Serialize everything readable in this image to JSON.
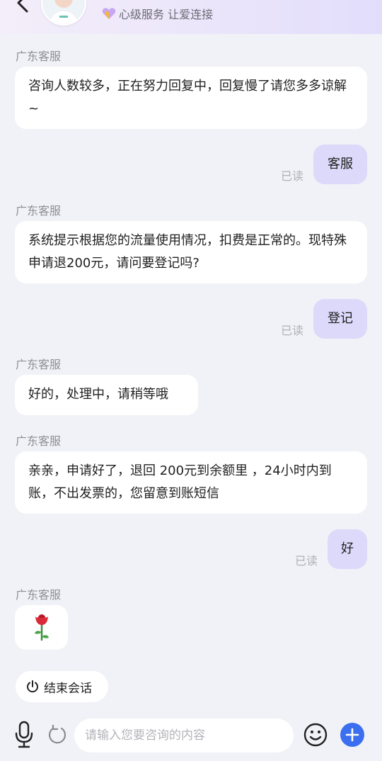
{
  "header": {
    "slogan": "心级服务 让爱连接"
  },
  "messages": [
    {
      "sender": "广东客服",
      "text": "咨询人数较多，正在努力回复中，回复慢了请您多多谅解~"
    },
    {
      "reply": "客服",
      "read": "已读"
    },
    {
      "sender": "广东客服",
      "text": "系统提示根据您的流量使用情况，扣费是正常的。现特殊申请退200元，请问要登记吗?"
    },
    {
      "reply": "登记",
      "read": "已读"
    },
    {
      "sender": "广东客服",
      "text": "好的，处理中，请稍等哦"
    },
    {
      "sender": "广东客服",
      "text": "亲亲，申请好了，退回 200元到余额里 ，24小时内到账，不出发票的，您留意到账短信"
    },
    {
      "reply": "好",
      "read": "已读"
    },
    {
      "sender": "广东客服",
      "emoji": "rose-emoji"
    }
  ],
  "end_chat": {
    "label": "结束会话"
  },
  "input": {
    "placeholder": "请输入您要咨询的内容"
  },
  "colors": {
    "accent": "#3b6ff0",
    "outgoing_bubble": "#dcd9fa",
    "background": "#f1f2f7"
  }
}
